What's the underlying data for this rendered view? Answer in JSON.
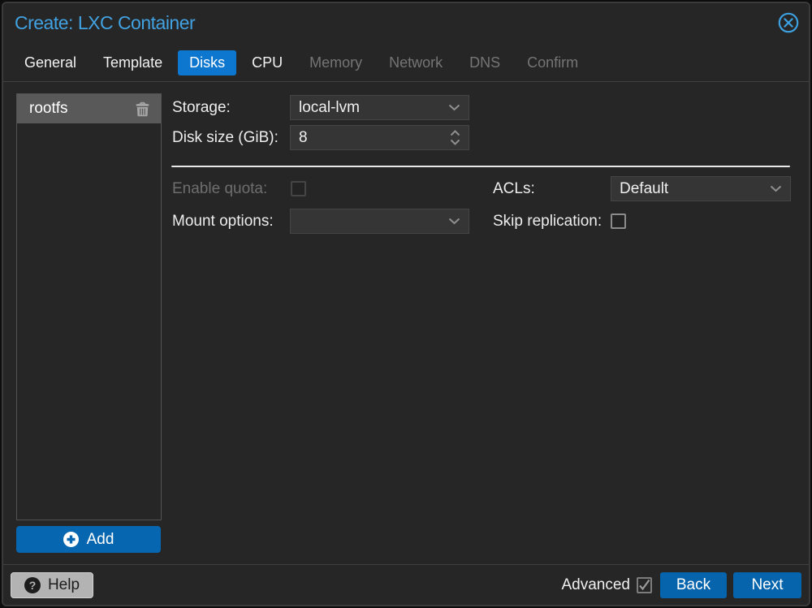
{
  "window": {
    "title": "Create: LXC Container"
  },
  "tabs": [
    {
      "label": "General",
      "state": "normal"
    },
    {
      "label": "Template",
      "state": "normal"
    },
    {
      "label": "Disks",
      "state": "active"
    },
    {
      "label": "CPU",
      "state": "normal"
    },
    {
      "label": "Memory",
      "state": "disabled"
    },
    {
      "label": "Network",
      "state": "disabled"
    },
    {
      "label": "DNS",
      "state": "disabled"
    },
    {
      "label": "Confirm",
      "state": "disabled"
    }
  ],
  "disk_list": {
    "items": [
      {
        "label": "rootfs",
        "selected": true
      }
    ],
    "add_button": "Add"
  },
  "form": {
    "storage": {
      "label": "Storage:",
      "value": "local-lvm"
    },
    "disk_size": {
      "label": "Disk size (GiB):",
      "value": "8"
    },
    "enable_quota": {
      "label": "Enable quota:",
      "checked": false,
      "disabled": true
    },
    "mount_options": {
      "label": "Mount options:",
      "value": ""
    },
    "acls": {
      "label": "ACLs:",
      "value": "Default"
    },
    "skip_replication": {
      "label": "Skip replication:",
      "checked": false
    }
  },
  "footer": {
    "help": "Help",
    "advanced": {
      "label": "Advanced",
      "checked": true
    },
    "back": "Back",
    "next": "Next"
  },
  "colors": {
    "title_blue": "#42a1e0",
    "tab_active_blue": "#0d76cf",
    "button_blue": "#0664ad"
  }
}
